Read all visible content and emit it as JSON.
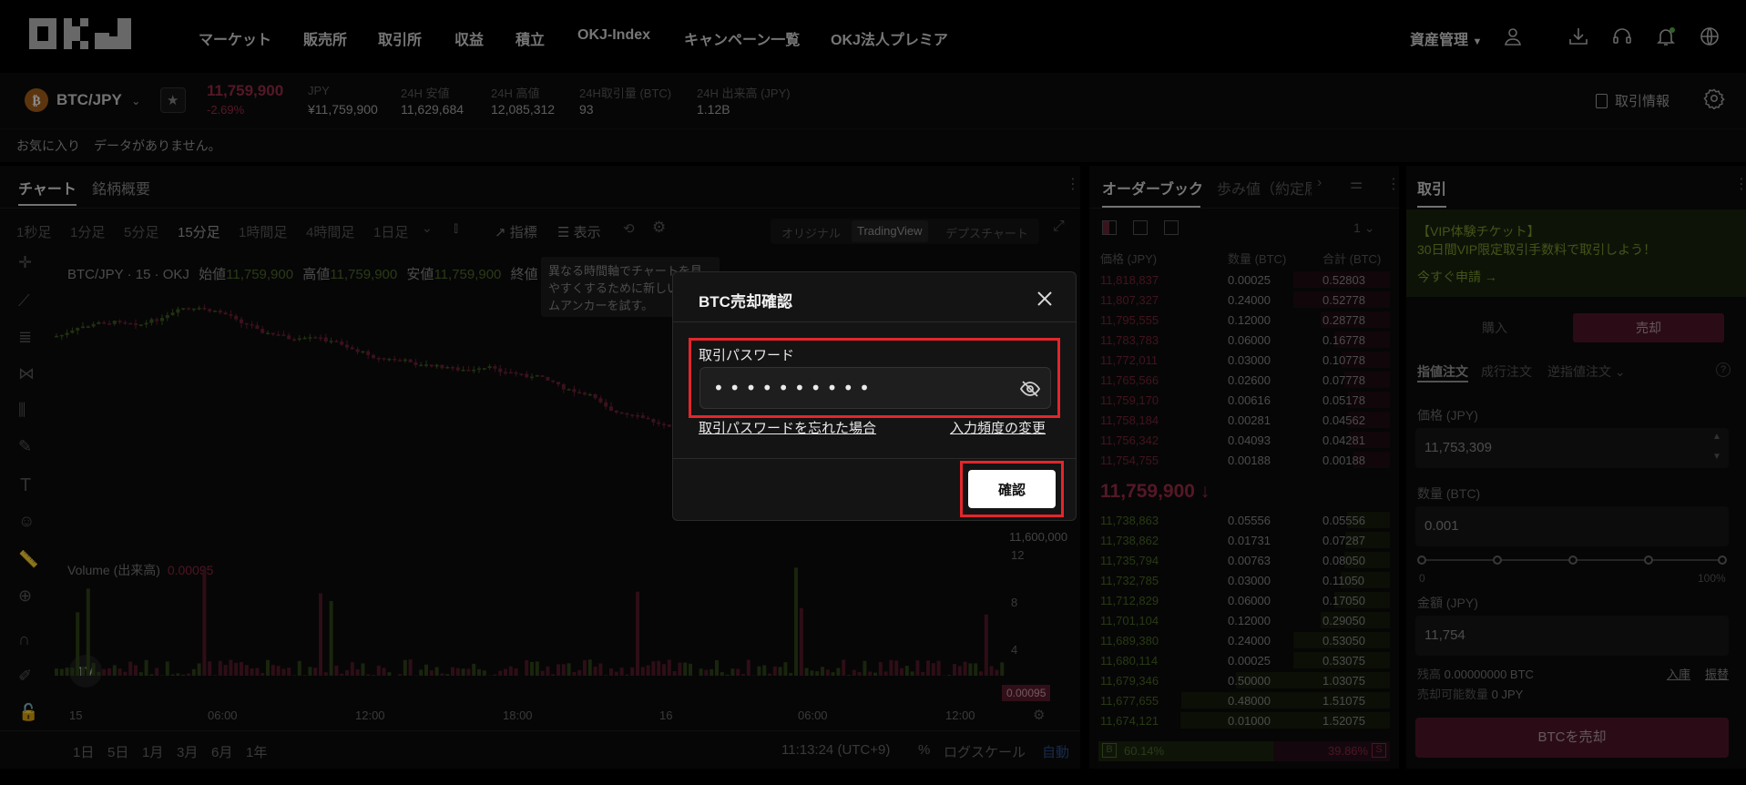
{
  "colors": {
    "accent_red": "#e3262b",
    "sell": "#8c2740",
    "buy": "#4f6a2b",
    "background": "#000000",
    "panel": "#0b0b0b"
  },
  "nav": {
    "logo": "OKJ",
    "items": [
      "マーケット",
      "販売所",
      "取引所",
      "収益",
      "積立",
      "OKJ-Index",
      "キャンペーン一覧",
      "OKJ法人プレミア"
    ],
    "asset_management": "資産管理",
    "icons": [
      "user-icon",
      "download-icon",
      "headset-icon",
      "bell-icon",
      "globe-icon"
    ]
  },
  "ticker": {
    "pair": "BTC/JPY",
    "price": "11,759,900",
    "change": "-2.69%",
    "stats": [
      {
        "label": "JPY",
        "value": "¥11,759,900"
      },
      {
        "label": "24H 安値",
        "value": "11,629,684"
      },
      {
        "label": "24H 高値",
        "value": "12,085,312"
      },
      {
        "label": "24H取引量 (BTC)",
        "value": "93"
      },
      {
        "label": "24H 出来高 (JPY)",
        "value": "1.12B"
      }
    ],
    "trade_info": "取引情報"
  },
  "favorites": {
    "label": "お気に入り",
    "empty": "データがありません。"
  },
  "chart": {
    "tabs": [
      "チャート",
      "銘柄概要"
    ],
    "timeframes": [
      "1秒足",
      "1分足",
      "5分足",
      "15分足",
      "1時間足",
      "4時間足",
      "1日足"
    ],
    "active_timeframe": "15分足",
    "tools": {
      "indicator": "指標",
      "display": "表示"
    },
    "view_modes": [
      "オリジナル",
      "TradingView",
      "デプスチャート"
    ],
    "active_view": "TradingView",
    "symbol_line": "BTC/JPY · 15 · OKJ",
    "ohlc": [
      {
        "label": "始値",
        "value": "11,759,900"
      },
      {
        "label": "高値",
        "value": "11,759,900"
      },
      {
        "label": "安値",
        "value": "11,759,900"
      },
      {
        "label": "終値",
        "value": ""
      }
    ],
    "tooltip": "異なる時間軸でチャートを見やすくするために新しいタイムアンカーを試す。",
    "price_axis_label": "11,600,000",
    "volume_label": "Volume (出来高)",
    "volume_value": "0.00095",
    "volume_ticks": [
      "12",
      "8",
      "4"
    ],
    "time_ticks": [
      "15",
      "06:00",
      "12:00",
      "18:00",
      "16",
      "06:00",
      "12:00"
    ],
    "ranges": [
      "1日",
      "5日",
      "1月",
      "3月",
      "6月",
      "1年"
    ],
    "clock": "11:13:24 (UTC+9)",
    "percent": "%",
    "log_scale": "ログスケール",
    "auto": "自動"
  },
  "orderbook": {
    "tabs": [
      "オーダーブック",
      "歩み値（約定履"
    ],
    "precision": "1",
    "headers": [
      "価格 (JPY)",
      "数量 (BTC)",
      "合計 (BTC)"
    ],
    "asks": [
      [
        "11,818,837",
        "0.00025",
        "0.52803"
      ],
      [
        "11,807,327",
        "0.24000",
        "0.52778"
      ],
      [
        "11,795,555",
        "0.12000",
        "0.28778"
      ],
      [
        "11,783,783",
        "0.06000",
        "0.16778"
      ],
      [
        "11,772,011",
        "0.03000",
        "0.10778"
      ],
      [
        "11,765,566",
        "0.02600",
        "0.07778"
      ],
      [
        "11,759,170",
        "0.00616",
        "0.05178"
      ],
      [
        "11,758,184",
        "0.00281",
        "0.04562"
      ],
      [
        "11,756,342",
        "0.04093",
        "0.04281"
      ],
      [
        "11,754,755",
        "0.00188",
        "0.00188"
      ]
    ],
    "last_price": "11,759,900 ↓",
    "bids": [
      [
        "11,738,863",
        "0.05556",
        "0.05556"
      ],
      [
        "11,738,862",
        "0.01731",
        "0.07287"
      ],
      [
        "11,735,794",
        "0.00763",
        "0.08050"
      ],
      [
        "11,732,785",
        "0.03000",
        "0.11050"
      ],
      [
        "11,712,829",
        "0.06000",
        "0.17050"
      ],
      [
        "11,701,104",
        "0.12000",
        "0.29050"
      ],
      [
        "11,689,380",
        "0.24000",
        "0.53050"
      ],
      [
        "11,680,114",
        "0.00025",
        "0.53075"
      ],
      [
        "11,679,346",
        "0.50000",
        "1.03075"
      ],
      [
        "11,677,655",
        "0.48000",
        "1.51075"
      ],
      [
        "11,674,121",
        "0.01000",
        "1.52075"
      ]
    ],
    "buy_ratio_label": "B",
    "buy_ratio": "60.14%",
    "sell_ratio": "39.86%",
    "sell_ratio_label": "S"
  },
  "trade": {
    "tab": "取引",
    "vip_title": "【VIP体験チケット】",
    "vip_desc": "30日間VIP限定取引手数料で取引しよう！",
    "vip_link": "今すぐ申請 →",
    "buy": "購入",
    "sell": "売却",
    "order_types": [
      "指値注文",
      "成行注文",
      "逆指値注文"
    ],
    "price_label": "価格 (JPY)",
    "price_value": "11,753,309",
    "qty_label": "数量 (BTC)",
    "qty_value": "0.001",
    "slider_min": "0",
    "slider_max": "100%",
    "slider_level": 1.0,
    "amount_label": "金額 (JPY)",
    "amount_value": "11,754",
    "balance_label": "残高",
    "balance_value": "0.00000000 BTC",
    "sellable_label": "売却可能数量",
    "sellable_value": "0 JPY",
    "deposit": "入庫",
    "transfer": "振替",
    "submit": "BTCを売却"
  },
  "modal": {
    "title": "BTC売却確認",
    "password_label": "取引パスワード",
    "password_value": "••••••••••",
    "forgot_link": "取引パスワードを忘れた場合",
    "frequency_link": "入力頻度の変更",
    "confirm": "確認"
  }
}
